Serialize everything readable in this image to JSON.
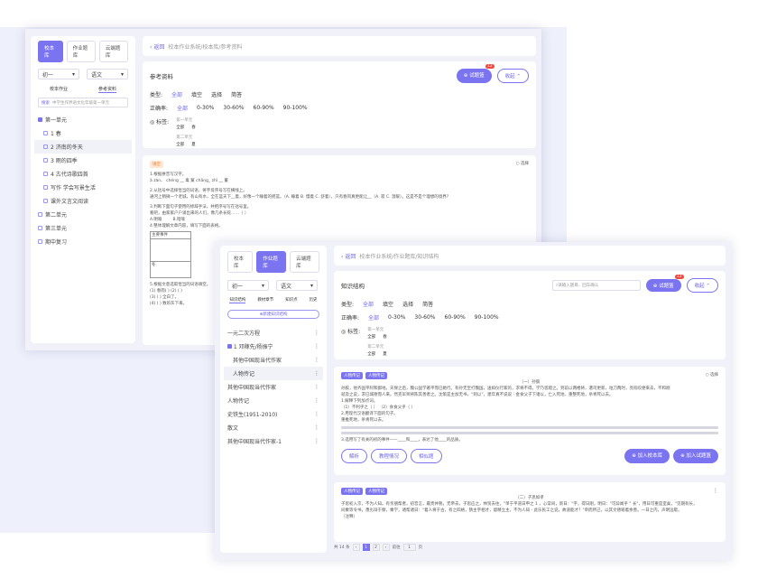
{
  "back": {
    "tabs": [
      "校本库",
      "作业题库",
      "云端题库"
    ],
    "grade": "初一",
    "subject": "语文",
    "subtabs": [
      "校本作业",
      "参考资料"
    ],
    "search_placeholder": "中学生作界语文化年级第一单元",
    "search_btn": "搜索",
    "tree": [
      {
        "label": "第一单元",
        "checked": true,
        "children": [
          "1 春",
          "2 济南的冬天",
          "3 雨的四季",
          "4 古代诗歌四首",
          "写作 学会写景生活",
          "课外文言文阅读"
        ]
      },
      {
        "label": "第二单元",
        "checked": false,
        "children": []
      },
      {
        "label": "第三单元",
        "checked": false,
        "children": []
      },
      {
        "label": "期中复习",
        "checked": false,
        "children": []
      }
    ],
    "breadcrumb_back": "返回",
    "breadcrumb": "校本作业系统/校本库/参考资料",
    "page_title": "参考资料",
    "basket_btn": "试题篮",
    "basket_count": "12",
    "collapse_btn": "收起",
    "filters": {
      "type_label": "类型:",
      "types": [
        "全部",
        "填空",
        "选择",
        "简答"
      ],
      "rate_label": "正确率:",
      "rates": [
        "全部",
        "0-30%",
        "30-60%",
        "60-90%",
        "90-100%"
      ],
      "tag_label": "标签:",
      "tag_groups": [
        {
          "name": "第一单元",
          "items": [
            "全部",
            "春"
          ]
        },
        {
          "name": "第二单元",
          "items": [
            "全部",
            "夏"
          ]
        }
      ]
    },
    "question": {
      "badge": "填空",
      "select": "选择",
      "lines": [
        "1.根据拼音写汉字。",
        "ǎ zàn、 chéng __ 毒 窠 chāng_ zhǐ __ 董",
        "2.从括号中选择恰当的词语，将字母序号写在横线上。",
        "通河上稍微一个老城，有山有水，全在蓝天下__着，好像一个睡着的摇篮。（A. 睡着 B. 慢着 C. 舒着），只有春风真更能让__（A. 寂 C. 温暖）。这是不是个理想的境界？",
        "3.判断下面句子使用的修辞手法，并把序号写在括号里。",
        "看吧，由家家户户涌出来的人们，像几条长蛇……（ ）",
        "4.整体理解文章内容，填写下面的表格。"
      ],
      "table_headers": [
        "主要事件"
      ],
      "table_row_label": "冬",
      "options": [
        "A.明喻",
        "B.暗喻"
      ],
      "tail": [
        "5.根据文意选取恰当的词语填空。",
        "(1) 春雨( ) (2) ( )",
        "(3) ( ) 全白了。",
        "(4) ( ) 数的灰下来。"
      ]
    }
  },
  "front": {
    "tabs": [
      "校本库",
      "作业题库",
      "云端题库"
    ],
    "grade": "初一",
    "subject": "语文",
    "subtabs": [
      "知识结构",
      "教材章节",
      "知识点",
      "历史"
    ],
    "new_btn": "新建知识结构",
    "tree": [
      {
        "label": "一元二次方程",
        "checked": false,
        "children": []
      },
      {
        "label": "1 邓稼先/杨振宁",
        "checked": true,
        "children": [
          "其他中国现当代作家",
          "人物传记"
        ]
      },
      {
        "label": "其他中国现当代作家",
        "checked": false,
        "children": []
      },
      {
        "label": "人物传记",
        "checked": false,
        "children": []
      },
      {
        "label": "史铁生(1951-2010)",
        "checked": false,
        "children": []
      },
      {
        "label": "散文",
        "checked": false,
        "children": []
      },
      {
        "label": "其他中国现当代作家-1",
        "checked": false,
        "children": []
      }
    ],
    "breadcrumb_back": "返回",
    "breadcrumb": "校本作业系统/作业题库/知识结构",
    "page_title": "知识结构",
    "search_placeholder": "请输入题目、回车确认",
    "basket_btn": "试题篮",
    "basket_count": "12",
    "collapse_btn": "收起",
    "filters": {
      "type_label": "类型:",
      "types": [
        "全部",
        "填空",
        "选择",
        "简答"
      ],
      "rate_label": "正确率:",
      "rates": [
        "全部",
        "0-30%",
        "30-60%",
        "60-90%",
        "90-100%"
      ],
      "tag_label": "标签:",
      "tag_groups": [
        {
          "name": "第一单元",
          "items": [
            "全部",
            "春"
          ]
        },
        {
          "name": "第二单元",
          "items": [
            "全部",
            "夏"
          ]
        }
      ]
    },
    "q1": {
      "chips": [
        "人物传记",
        "人物传记"
      ],
      "select": "选择",
      "title": "（一）孙膑",
      "lines": [
        "孙膑，他齐国平阿和鄄地。天保之后，魏公国学著平而已她行。有孙无至打魏国，送如仪行家的，求将不得，学乃皆蹬之。到前以两楼将，遣司更新，咕刀两时，亮咬叹便来去，不和刚",
        "就及之说，求已城德而人来。然克军师将陈其善者之。沈策是主加无书，“则以”，建年真不说说 · 金食父子下诸以，亡入死地、重整死地，杀青死以去。",
        "1.解释下列加点词。",
        "（1）不利乎之（ ） （2）食食父乎（ ）",
        "2.用现代汉语翻译下面的句子。",
        "重推死地，杀青死以去。",
        "3.选用写了有关的初的事件——____和____，表达了他____的品质。"
      ],
      "btns": [
        "解析",
        "教程情况",
        "相似题"
      ],
      "add_school": "加入校本库",
      "add_basket": "加入试题篮"
    },
    "q2": {
      "chips": [
        "人物传记",
        "人物传记"
      ],
      "title": "（二）子思如孝",
      "lines": [
        "子思初入京，不为人知。有亲朋帮者，初音言，最贵并税，无帝去，子思应之，林贸去往，\"单于平道日申之 1 ，心常间，新日：\"字，得日刚，明日：\"可异闻乎 \" 长\"，用日可重是室矣，\"见期有长，",
        "间乘等令书，愚劣辩于察，乘学，诸帮诸日：\"着人将于古，有之四格，猜主字相才，督精立主，不为人知 - 此乐民工之说，故道能才？\"单而所己，以其文德喻着余善。一日之内，声明远歇。",
        "（注释）"
      ]
    },
    "pager": {
      "total": "共 14 条",
      "pages": [
        "1",
        "2"
      ],
      "goto_label": "前往",
      "goto_value": "1",
      "unit": "页"
    }
  }
}
